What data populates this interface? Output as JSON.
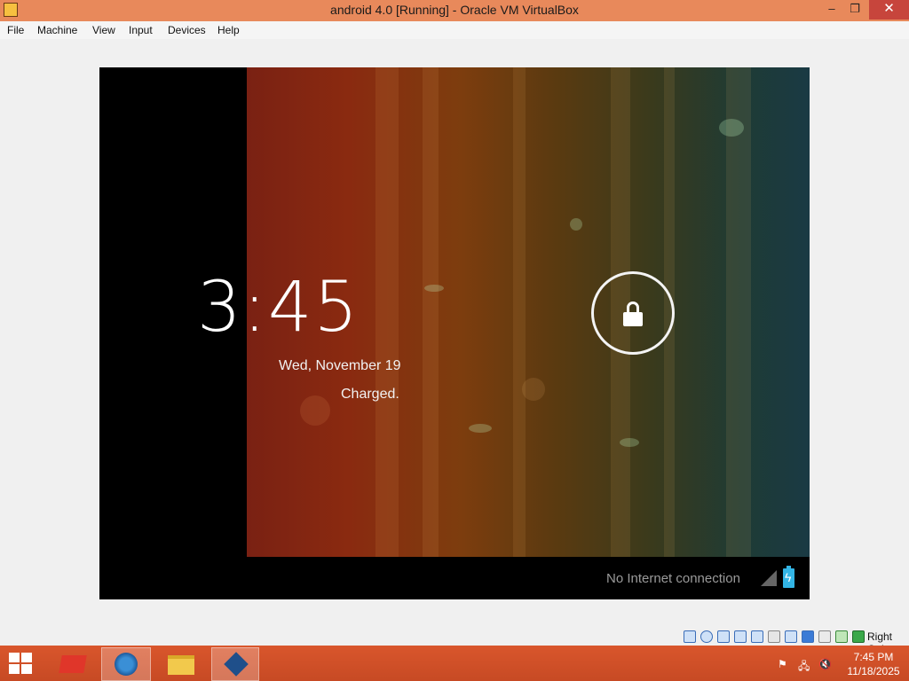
{
  "window": {
    "title": "android 4.0 [Running] - Oracle VM VirtualBox",
    "minimize_glyph": "–",
    "maximize_glyph": "❐",
    "close_glyph": "✕"
  },
  "menubar": {
    "items": [
      "File",
      "Machine",
      "View",
      "Input",
      "Devices",
      "Help"
    ]
  },
  "android": {
    "time": "3:45",
    "date": "Wed, November 19",
    "battery_status": "Charged.",
    "network_status": "No Internet connection",
    "unlock_icon": "lock-icon"
  },
  "vm_status": {
    "host_key": "Right Ctrl",
    "icons": [
      "hard-disk-icon",
      "optical-drive-icon",
      "audio-icon",
      "network-icon",
      "usb-icon",
      "shared-folder-icon",
      "display-icon",
      "video-capture-icon",
      "virtualization-icon",
      "mouse-integration-icon",
      "keyboard-icon"
    ]
  },
  "taskbar": {
    "apps": [
      "start-icon",
      "toolbox-icon",
      "browser-icon",
      "file-explorer-icon",
      "virtualbox-icon"
    ],
    "active_app": "virtualbox-icon",
    "clock_time": "7:45 PM",
    "clock_date": "11/18/2025"
  },
  "colors": {
    "titlebar": "#e8895b",
    "taskbar": "#c74a24",
    "android_accent": "#33b5e5"
  }
}
